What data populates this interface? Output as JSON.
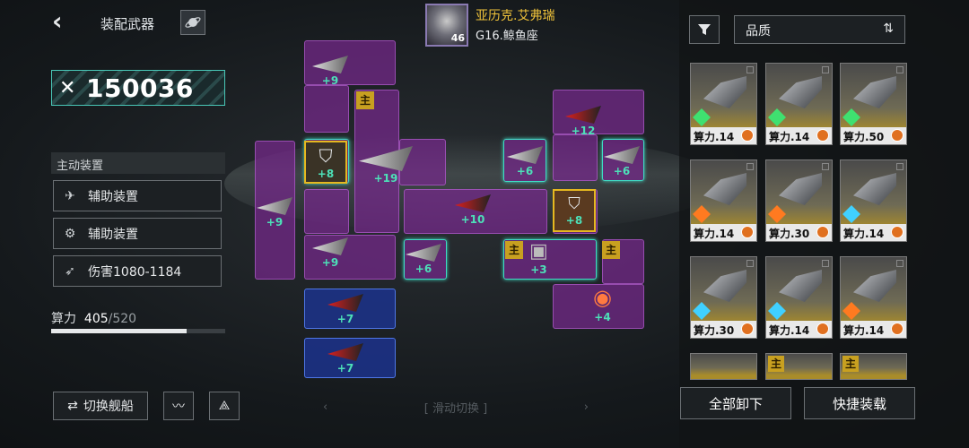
{
  "header": {
    "back_icon": "chevron-left-icon",
    "title": "装配武器",
    "planet_icon": "planet-icon",
    "pilot_name": "亚历克.艾弗瑞",
    "pilot_level": "46",
    "ship_name": "G16.鲸鱼座"
  },
  "left": {
    "combat_power": "150036",
    "section_title": "主动装置",
    "rows": [
      {
        "label": "辅助装置",
        "icon": "drone-icon"
      },
      {
        "label": "辅助装置",
        "icon": "gear-icon"
      },
      {
        "label": "伤害1080-1184",
        "icon": "damage-icon"
      }
    ],
    "capacity_label": "算力",
    "capacity_used": "405",
    "capacity_total": "/520",
    "capacity_fraction": 0.779,
    "switch_ship": "切换舰船"
  },
  "grid": {
    "levels": [
      "+9",
      "+8",
      "+19",
      "+9",
      "+9",
      "+6",
      "+10",
      "+7",
      "+7",
      "+12",
      "+6",
      "+6",
      "+8",
      "+3",
      "+4"
    ],
    "main_tag": "主"
  },
  "swipe_label": "滑动切换",
  "right": {
    "filter_icon": "filter-icon",
    "sort_label": "品质",
    "cards": [
      {
        "label": "算力.14",
        "element": "#3fe070"
      },
      {
        "label": "算力.14",
        "element": "#3fe070"
      },
      {
        "label": "算力.50",
        "element": "#3fe070"
      },
      {
        "label": "算力.14",
        "element": "#ff7a20"
      },
      {
        "label": "算力.30",
        "element": "#ff7a20"
      },
      {
        "label": "算力.14",
        "element": "#40d0ff"
      },
      {
        "label": "算力.30",
        "element": "#40d0ff"
      },
      {
        "label": "算力.14",
        "element": "#40d0ff"
      },
      {
        "label": "算力.14",
        "element": "#ff7a20"
      }
    ],
    "unequip_all": "全部卸下",
    "quick_equip": "快捷装载"
  }
}
